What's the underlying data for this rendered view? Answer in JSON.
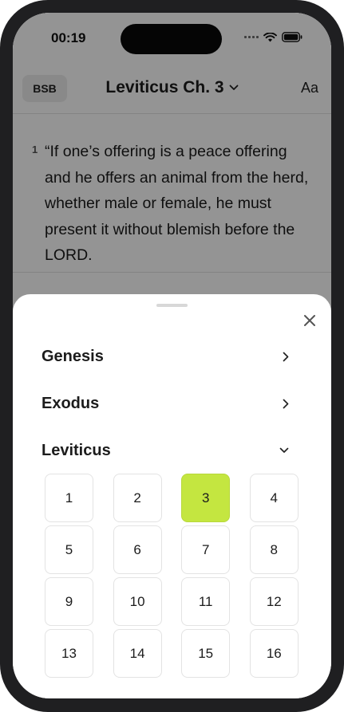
{
  "status_bar": {
    "time": "00:19"
  },
  "header": {
    "version_label": "BSB",
    "title": "Leviticus Ch. 3",
    "font_button_label": "Aa"
  },
  "verse": {
    "number": "1",
    "text": "“If one’s offering is a peace offering and he offers an animal from the herd, whether male or female, he must present it without blemish before the LORD."
  },
  "sheet": {
    "books": [
      {
        "name": "Genesis",
        "expanded": false
      },
      {
        "name": "Exodus",
        "expanded": false
      },
      {
        "name": "Leviticus",
        "expanded": true
      }
    ],
    "chapters": [
      "1",
      "2",
      "3",
      "4",
      "5",
      "6",
      "7",
      "8",
      "9",
      "10",
      "11",
      "12",
      "13",
      "14",
      "15",
      "16"
    ],
    "selected_chapter": "3",
    "accent_color": "#c4e640"
  }
}
